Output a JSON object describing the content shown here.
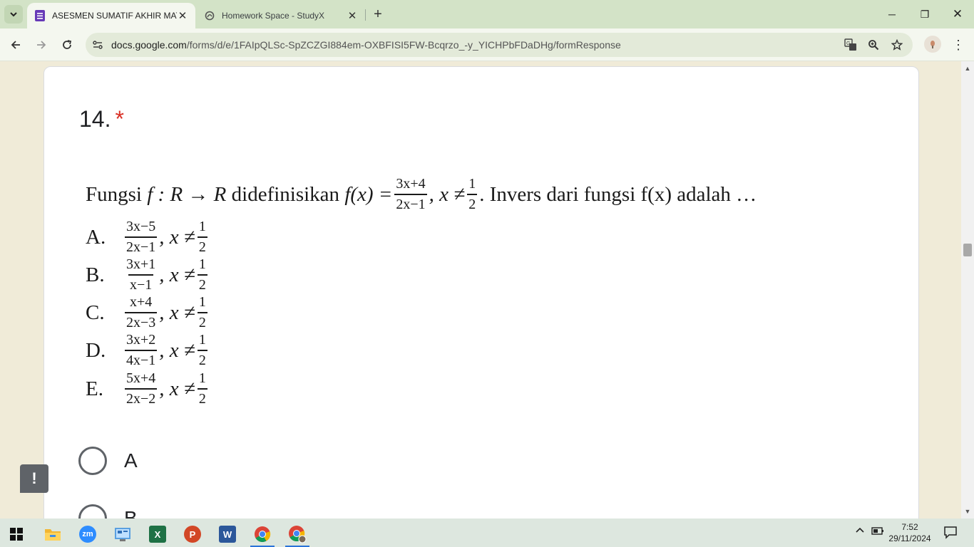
{
  "browser": {
    "tabs": [
      {
        "title": "ASESMEN SUMATIF AKHIR MAT",
        "active": true,
        "favicon": "google-forms-icon"
      },
      {
        "title": "Homework Space - StudyX",
        "active": false,
        "favicon": "studyx-icon"
      }
    ],
    "url_host": "docs.google.com",
    "url_path": "/forms/d/e/1FAIpQLSc-SpZCZGI884em-OXBFISI5FW-Bcqrzo_-y_YICHPbFDaDHg/formResponse"
  },
  "question": {
    "number": "14.",
    "required_mark": "*",
    "stem": {
      "lead": "Fungsi",
      "mapping": "f : R → R",
      "defined": "didefinisikan",
      "fx": "f(x) =",
      "num": "3x+4",
      "den": "2x−1",
      "cond": ", x ≠",
      "cond_num": "1",
      "cond_den": "2",
      "tail": ". Invers dari fungsi f(x) adalah …"
    },
    "options": [
      {
        "letter": "A.",
        "num": "3x−5",
        "den": "2x−1",
        "cond": ", x ≠",
        "cond_num": "1",
        "cond_den": "2"
      },
      {
        "letter": "B.",
        "num": "3x+1",
        "den": "x−1",
        "cond": ", x ≠",
        "cond_num": "1",
        "cond_den": "2"
      },
      {
        "letter": "C.",
        "num": "x+4",
        "den": "2x−3",
        "cond": ", x ≠",
        "cond_num": "1",
        "cond_den": "2"
      },
      {
        "letter": "D.",
        "num": "3x+2",
        "den": "4x−1",
        "cond": ", x ≠",
        "cond_num": "1",
        "cond_den": "2"
      },
      {
        "letter": "E.",
        "num": "5x+4",
        "den": "2x−2",
        "cond": ", x ≠",
        "cond_num": "1",
        "cond_den": "2"
      }
    ],
    "choices": [
      "A",
      "B"
    ]
  },
  "feedback_label": "!",
  "taskbar": {
    "apps": [
      "windows-start-icon",
      "file-explorer-icon",
      "zoom-icon",
      "control-panel-icon",
      "excel-icon",
      "powerpoint-icon",
      "word-icon",
      "chrome-icon",
      "chrome-profile-icon"
    ],
    "time": "7:52",
    "date": "29/11/2024"
  }
}
